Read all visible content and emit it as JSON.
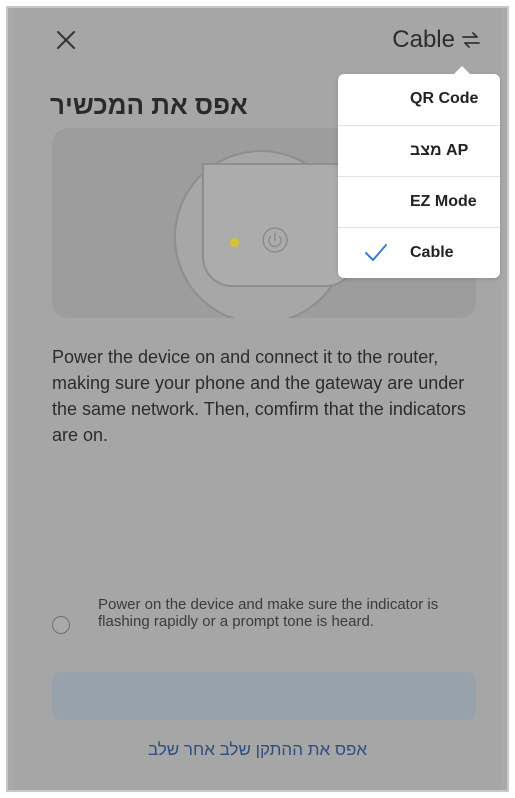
{
  "header": {
    "close_icon": "close-icon",
    "mode_label": "Cable",
    "swap_icon": "swap-icon"
  },
  "page": {
    "title": "אפס את המכשיר"
  },
  "illustration": {
    "led_color": "#d7c32d",
    "power_icon": "power-icon"
  },
  "instructions": {
    "text": "Power the device on and connect it to the router, making sure your phone and the gateway are under the same network. Then, comfirm that the indicators are on."
  },
  "confirmation": {
    "checked": false,
    "text": "Power on the device and make sure the indicator is flashing rapidly or a prompt tone is heard."
  },
  "actions": {
    "alt_link": "אפס את ההתקן שלב אחר שלב"
  },
  "mode_menu": {
    "items": [
      {
        "label": "QR Code",
        "selected": false
      },
      {
        "label": "מצב AP",
        "selected": false
      },
      {
        "label": "EZ Mode",
        "selected": false
      },
      {
        "label": "Cable",
        "selected": true
      }
    ],
    "check_icon": "check-icon"
  },
  "colors": {
    "accent": "#3a7bd5",
    "overlay": "#a6a6a6"
  }
}
